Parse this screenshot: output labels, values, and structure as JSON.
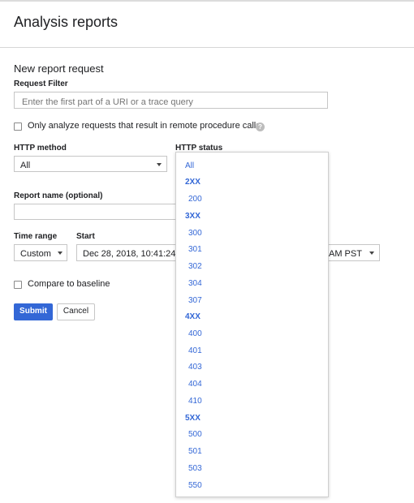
{
  "header": {
    "title": "Analysis reports"
  },
  "form": {
    "section_title": "New report request",
    "request_filter": {
      "label": "Request Filter",
      "placeholder": "Enter the first part of a URI or a trace query"
    },
    "rpc_checkbox": {
      "label": "Only analyze requests that result in remote procedure calls",
      "checked": false
    },
    "http_method": {
      "label": "HTTP method",
      "value": "All"
    },
    "http_status": {
      "label": "HTTP status"
    },
    "report_name": {
      "label": "Report name (optional)",
      "value": ""
    },
    "time_range": {
      "label": "Time range",
      "value": "Custom"
    },
    "start": {
      "label": "Start",
      "value": "Dec 28, 2018, 10:41:24 A",
      "tz_value": "AM PST"
    },
    "baseline_checkbox": {
      "label": "Compare to baseline",
      "checked": false
    },
    "buttons": {
      "submit": "Submit",
      "cancel": "Cancel"
    }
  },
  "status_dropdown": {
    "options": [
      "All",
      "2XX",
      "200",
      "3XX",
      "300",
      "301",
      "302",
      "304",
      "307",
      "4XX",
      "400",
      "401",
      "403",
      "404",
      "410",
      "5XX",
      "500",
      "501",
      "503",
      "550"
    ],
    "group_headers": [
      "2XX",
      "3XX",
      "4XX",
      "5XX"
    ]
  },
  "colors": {
    "accent": "#3367d6",
    "divider": "#d6d6d6",
    "text": "#202124"
  },
  "icons": {
    "help": "help-circle-icon",
    "caret": "caret-down-icon"
  }
}
